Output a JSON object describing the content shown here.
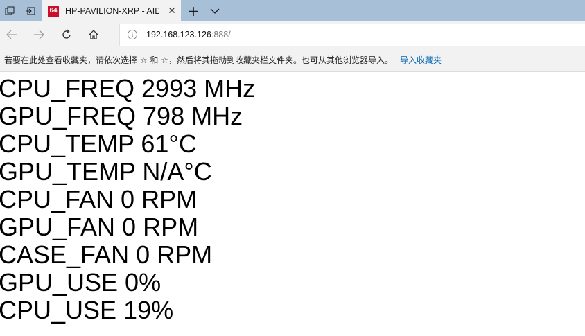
{
  "tab": {
    "favicon_text": "64",
    "title": "HP-PAVILION-XRP - AID"
  },
  "address": {
    "host": "192.168.123.126",
    "port_path": ":888/"
  },
  "favorites": {
    "hint": "若要在此处查看收藏夹，请依次选择 ☆ 和 ☆，然后将其拖动到收藏夹栏文件夹。也可从其他浏览器导入。",
    "import_link": "导入收藏夹"
  },
  "stats": [
    "CPU_FREQ 2993 MHz",
    "GPU_FREQ 798 MHz",
    "CPU_TEMP 61°C",
    "GPU_TEMP N/A°C",
    "CPU_FAN 0 RPM",
    "GPU_FAN 0 RPM",
    "CASE_FAN 0 RPM",
    "GPU_USE 0%",
    "CPU_USE 19%"
  ]
}
